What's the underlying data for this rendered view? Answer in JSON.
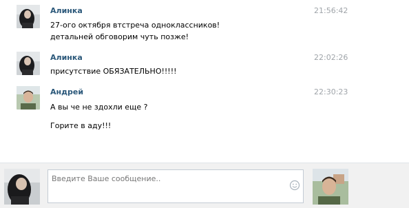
{
  "messages": [
    {
      "author": "Алинка",
      "time": "21:56:42",
      "lines": [
        "27-ого октября втстреча одноклассников!",
        "детальней обговорим чуть позже!"
      ]
    },
    {
      "author": "Алинка",
      "time": "22:02:26",
      "lines": [
        "присутствие ОБЯЗАТЕЛЬНО!!!!!"
      ]
    },
    {
      "author": "Андрей",
      "time": "22:30:23",
      "lines": [
        "А вы че не здохли еще ?",
        "Горите в аду!!!"
      ]
    }
  ],
  "composer": {
    "placeholder": "Введите Ваше сообщение..",
    "icon": "smile-icon"
  },
  "colors": {
    "author": "#2b587a",
    "time": "#9fa4a9",
    "composer_bg": "#f1f1f1"
  }
}
